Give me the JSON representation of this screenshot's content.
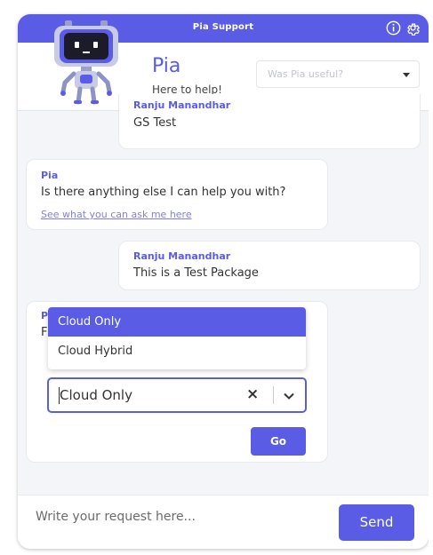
{
  "window": {
    "title": "Pia Support"
  },
  "header": {
    "bot_name": "Pia",
    "bot_subtitle": "Here to help!",
    "feedback_placeholder": "Was Pia useful?"
  },
  "icons": {
    "info": "info-icon",
    "settings": "gear-icon",
    "feedback_caret": "caret-down-icon",
    "clear": "clear-x-icon",
    "chevron": "chevron-down-icon"
  },
  "colors": {
    "accent": "#5b5ce6",
    "link": "#7f80e8"
  },
  "messages": [
    {
      "author": "Ranju Manandhar",
      "text": "GS Test"
    },
    {
      "author": "Pia",
      "text": "Is there anything else I can help you with?",
      "link": "See what you can ask me here"
    },
    {
      "author": "Ranju Manandhar",
      "text": "This is a Test Package"
    },
    {
      "author_initial": "P",
      "text_initial": "F"
    }
  ],
  "package_select": {
    "options": [
      "Cloud Only",
      "Cloud Hybrid"
    ],
    "selected": "Cloud Only",
    "clear_symbol": "×",
    "go_label": "Go"
  },
  "composer": {
    "placeholder": "Write your request here...",
    "send_label": "Send"
  }
}
